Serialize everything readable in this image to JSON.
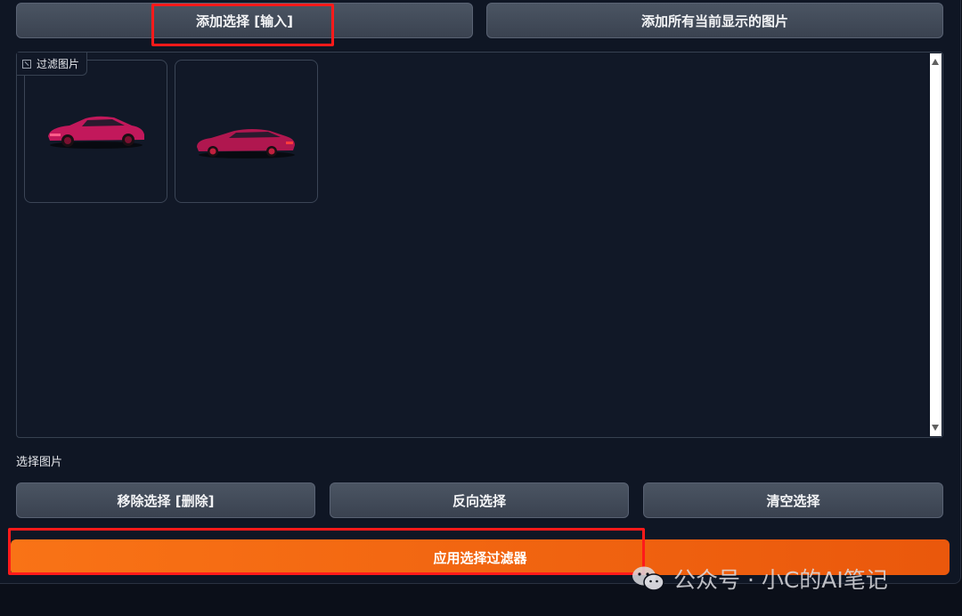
{
  "top_buttons": {
    "add_selection": "添加选择 [输入]",
    "add_all_visible": "添加所有当前显示的图片"
  },
  "gallery": {
    "label": "过滤图片",
    "images": [
      {
        "name": "pink-sedan-image-1",
        "color": "#c2185b"
      },
      {
        "name": "pink-sedan-image-2",
        "color": "#b0174f"
      }
    ]
  },
  "selection": {
    "label": "选择图片",
    "remove": "移除选择 [删除]",
    "invert": "反向选择",
    "clear": "清空选择"
  },
  "apply_button": "应用选择过滤器",
  "watermark": "公众号 · 小C的AI笔记",
  "colors": {
    "accent_orange": "#f97316",
    "highlight_red": "#ff1a1a"
  }
}
